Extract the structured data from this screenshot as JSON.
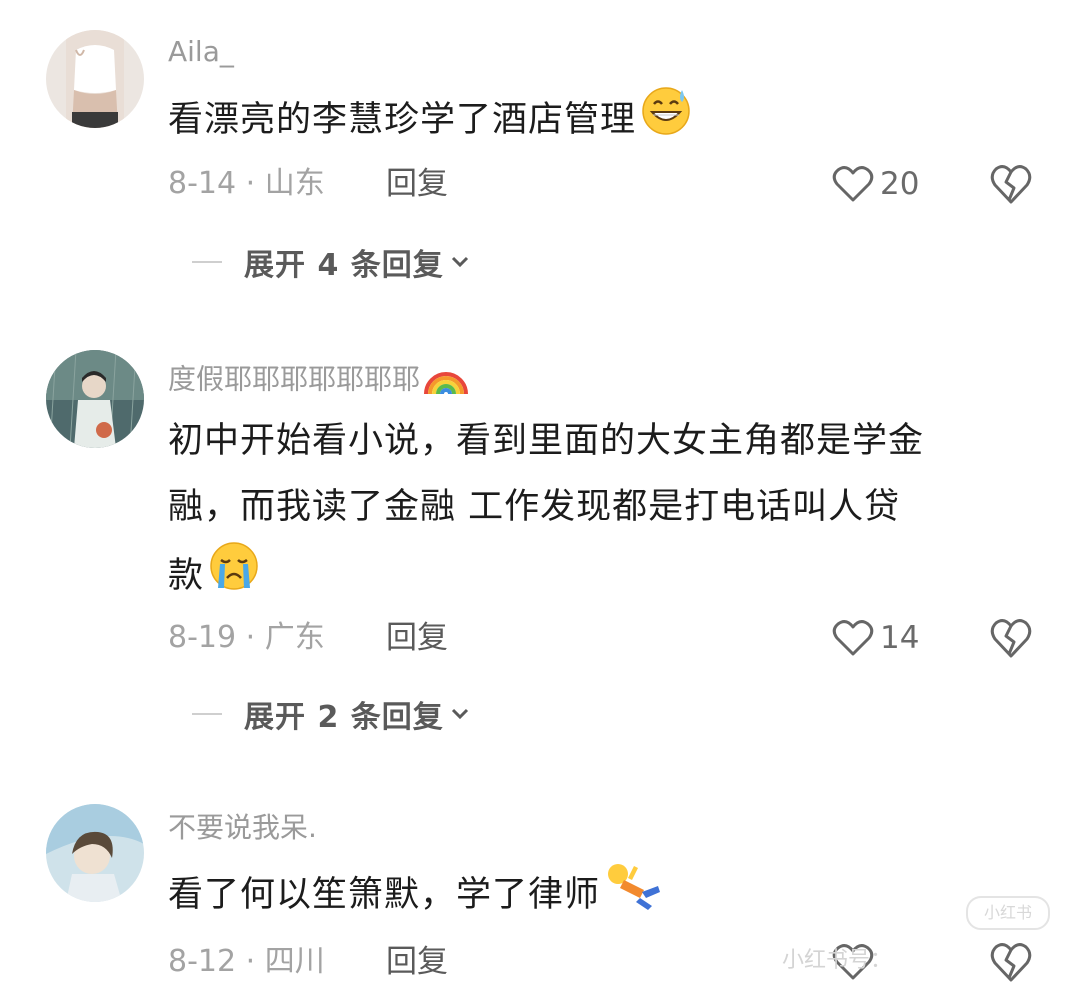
{
  "comments": [
    {
      "username": "Aila_",
      "text": "看漂亮的李慧珍学了酒店管理",
      "emoji": "grinning-sweat-emoji",
      "date_location": "8-14 · 山东",
      "reply_label": "回复",
      "likes": "20",
      "expand_label": "展开 4 条回复"
    },
    {
      "username": "度假耶耶耶耶耶耶耶",
      "username_emoji": "rainbow-emoji",
      "text_lines": [
        "初中开始看小说，看到里面的大女主角都是学金",
        "融，而我读了金融  工作发现都是打电话叫人贷",
        "款"
      ],
      "emoji": "crying-face-emoji",
      "date_location": "8-19 · 广东",
      "reply_label": "回复",
      "likes": "14",
      "expand_label": "展开 2 条回复"
    },
    {
      "username": "不要说我呆.",
      "text": "看了何以笙箫默，学了律师",
      "emoji": "fallen-person-emoji",
      "date_location": "8-12 · 四川",
      "reply_label": "回复",
      "likes": ""
    }
  ],
  "watermark": {
    "badge_text": "小红书",
    "footer_text": "小红书号："
  },
  "colors": {
    "username": "#9a9a9a",
    "text": "#1c1c1c",
    "meta": "#a3a3a3",
    "action": "#5a5a5a"
  }
}
